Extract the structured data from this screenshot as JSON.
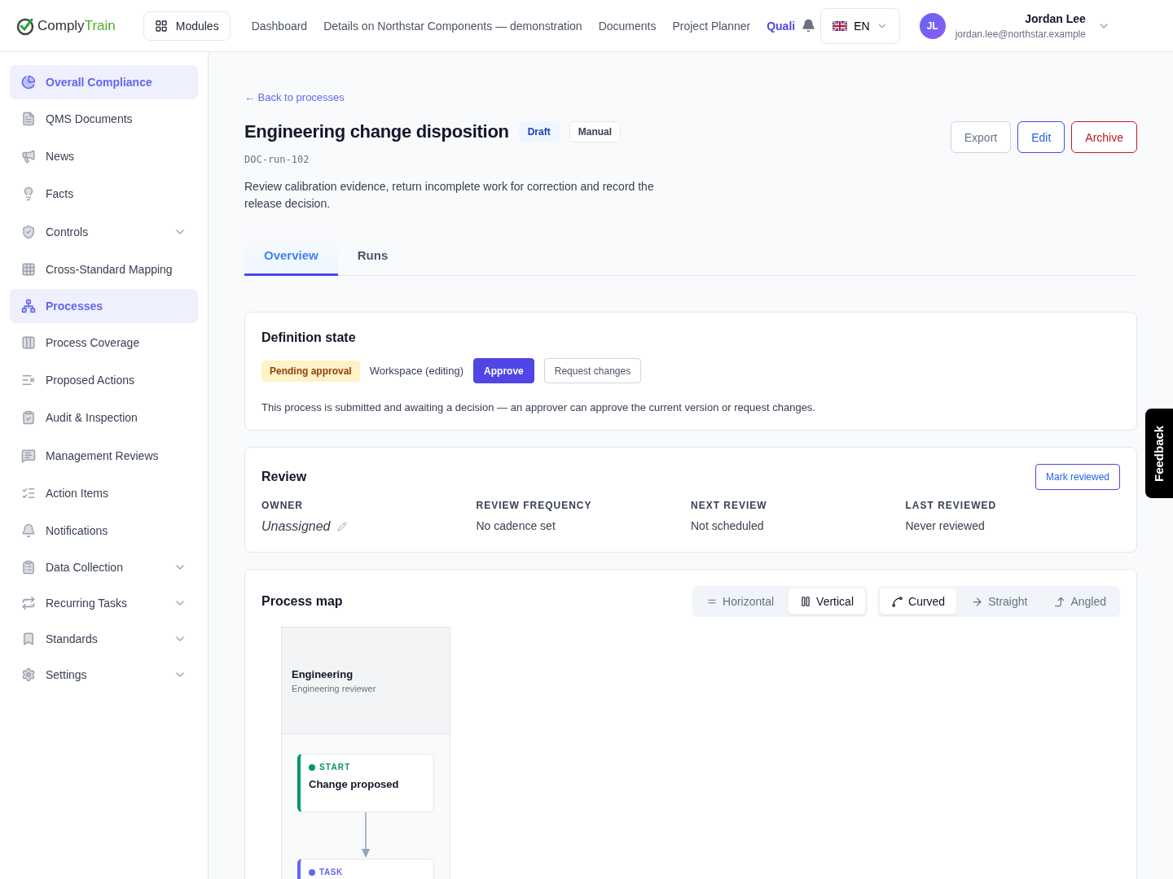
{
  "header": {
    "logo": {
      "first": "Comply",
      "second": "Train"
    },
    "modules_button": "Modules",
    "nav": [
      {
        "label": "Dashboard",
        "selected": false
      },
      {
        "label": "Details on Northstar Components — demonstration",
        "selected": false
      },
      {
        "label": "Documents",
        "selected": false
      },
      {
        "label": "Project Planner",
        "selected": false
      },
      {
        "label": "Quali",
        "selected": true
      }
    ],
    "language": "EN",
    "user": {
      "initials": "JL",
      "name": "Jordan Lee",
      "email": "jordan.lee@northstar.example"
    }
  },
  "sidebar": {
    "items": [
      {
        "label": "Overall Compliance",
        "selected": true,
        "expandable": false
      },
      {
        "label": "QMS Documents",
        "selected": false,
        "expandable": false
      },
      {
        "label": "News",
        "selected": false,
        "expandable": false
      },
      {
        "label": "Facts",
        "selected": false,
        "expandable": false
      },
      {
        "label": "Controls",
        "selected": false,
        "expandable": true
      },
      {
        "label": "Cross-Standard Mapping",
        "selected": false,
        "expandable": false
      },
      {
        "label": "Processes",
        "selected": true,
        "expandable": false
      },
      {
        "label": "Process Coverage",
        "selected": false,
        "expandable": false
      },
      {
        "label": "Proposed Actions",
        "selected": false,
        "expandable": false
      },
      {
        "label": "Audit & Inspection",
        "selected": false,
        "expandable": false
      },
      {
        "label": "Management Reviews",
        "selected": false,
        "expandable": false
      },
      {
        "label": "Action Items",
        "selected": false,
        "expandable": false
      },
      {
        "label": "Notifications",
        "selected": false,
        "expandable": false
      },
      {
        "label": "Data Collection",
        "selected": false,
        "expandable": true
      },
      {
        "label": "Recurring Tasks",
        "selected": false,
        "expandable": true
      },
      {
        "label": "Standards",
        "selected": false,
        "expandable": true
      },
      {
        "label": "Settings",
        "selected": false,
        "expandable": true
      }
    ]
  },
  "page": {
    "back_link": "← Back to processes",
    "title": "Engineering change disposition",
    "badges": [
      {
        "label": "Draft",
        "kind": "status"
      },
      {
        "label": "Manual",
        "kind": "outline"
      }
    ],
    "doc_id": "DOC-run-102",
    "description": "Review calibration evidence, return incomplete work for correction and record the release decision.",
    "actions": [
      {
        "label": "Export",
        "kind": "neutral"
      },
      {
        "label": "Edit",
        "kind": "primary"
      },
      {
        "label": "Archive",
        "kind": "danger"
      }
    ],
    "tabs": [
      {
        "label": "Overview",
        "selected": true
      },
      {
        "label": "Runs",
        "selected": false
      }
    ]
  },
  "definition": {
    "title": "Definition state",
    "status": "Pending approval",
    "mode": "Workspace (editing)",
    "buttons": [
      {
        "label": "Approve",
        "kind": "primary"
      },
      {
        "label": "Request changes",
        "kind": "outline"
      }
    ],
    "note": "This process is submitted and awaiting a decision — an approver can approve the current version or request changes."
  },
  "review": {
    "title": "Review",
    "button": "Mark reviewed",
    "fields": [
      {
        "label": "OWNER",
        "value": "Unassigned",
        "editable": true
      },
      {
        "label": "REVIEW FREQUENCY",
        "value": "No cadence set",
        "editable": false
      },
      {
        "label": "NEXT REVIEW",
        "value": "Not scheduled",
        "editable": false
      },
      {
        "label": "LAST REVIEWED",
        "value": "Never reviewed",
        "editable": false
      }
    ]
  },
  "process_map": {
    "title": "Process map",
    "orientation": [
      {
        "label": "Horizontal",
        "selected": false
      },
      {
        "label": "Vertical",
        "selected": true
      }
    ],
    "edges": [
      {
        "label": "Curved",
        "selected": true
      },
      {
        "label": "Straight",
        "selected": false
      },
      {
        "label": "Angled",
        "selected": false
      }
    ],
    "lane": {
      "name": "Engineering",
      "role": "Engineering reviewer"
    },
    "nodes": [
      {
        "kind": "start",
        "label": "START",
        "title": "Change proposed",
        "color": "#059669"
      },
      {
        "kind": "task",
        "label": "TASK",
        "color": "#6366f1"
      }
    ]
  },
  "feedback": "Feedback"
}
